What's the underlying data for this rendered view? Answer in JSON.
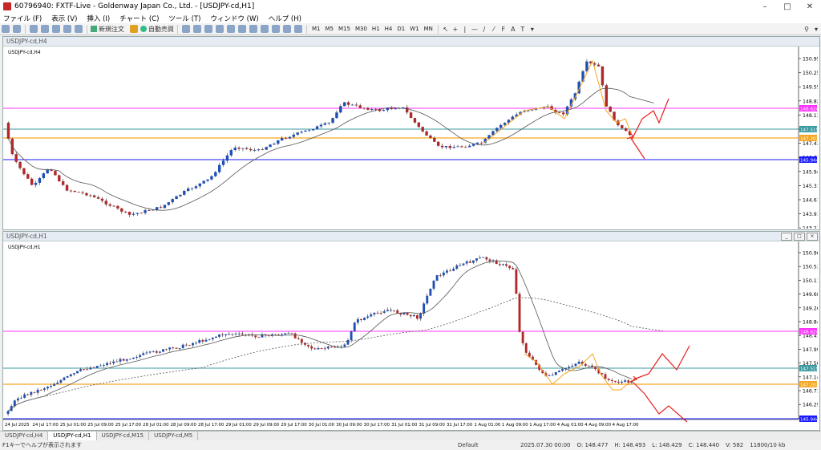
{
  "window": {
    "title": "60796940: FXTF-Live - Goldenway Japan Co., Ltd. - [USDJPY-cd,H1]"
  },
  "menu": [
    "ファイル (F)",
    "表示 (V)",
    "挿入 (I)",
    "チャート (C)",
    "ツール (T)",
    "ウィンドウ (W)",
    "ヘルプ (H)"
  ],
  "toolbar": {
    "new_order": "新規注文",
    "auto_trading": "自動売買",
    "timeframes": [
      "M1",
      "M5",
      "M15",
      "M30",
      "H1",
      "H4",
      "D1",
      "W1",
      "MN"
    ]
  },
  "colors": {
    "bull": "#1f4fb5",
    "bear": "#b0282a",
    "magenta": "#ff33ff",
    "teal": "#3a9aa0",
    "orange": "#f5a623",
    "blue": "#1a1aff",
    "red": "#e8201c"
  },
  "chart_h4": {
    "title": "USDJPY-cd,H4",
    "price_labels": [
      "150.950",
      "150.250",
      "149.550",
      "148.820",
      "148.130",
      "147.515",
      "147.430",
      "146.730",
      "145.944",
      "145.310",
      "144.610",
      "143.910",
      "143.210"
    ],
    "levels": {
      "magenta": "148.624",
      "teal": "147.515",
      "orange": "147.203",
      "blue": "145.944"
    }
  },
  "chart_h1": {
    "title": "USDJPY-cd,H1",
    "price_labels": [
      "150.960",
      "150.530",
      "150.110",
      "149.680",
      "149.260",
      "148.840",
      "148.410",
      "147.990",
      "147.560",
      "147.140",
      "146.710",
      "146.290",
      "145.860"
    ],
    "levels": {
      "magenta": "148.624",
      "teal": "147.515",
      "orange": "147.203",
      "blue": "145.944"
    },
    "time_labels": [
      "24 Jul 2025",
      "24 Jul 17:00",
      "25 Jul 01:00",
      "25 Jul 09:00",
      "25 Jul 17:00",
      "28 Jul 01:00",
      "28 Jul 09:00",
      "28 Jul 17:00",
      "29 Jul 01:00",
      "29 Jul 09:00",
      "29 Jul 17:00",
      "30 Jul 01:00",
      "30 Jul 09:00",
      "30 Jul 17:00",
      "31 Jul 01:00",
      "31 Jul 09:00",
      "31 Jul 17:00",
      "1 Aug 01:00",
      "1 Aug 09:00",
      "1 Aug 17:00",
      "4 Aug 01:00",
      "4 Aug 09:00",
      "4 Aug 17:00"
    ]
  },
  "tabs": [
    "USDJPY-cd,H4",
    "USDJPY-cd,H1",
    "USDJPY-cd,M15",
    "USDJPY-cd,M5"
  ],
  "active_tab": 1,
  "status": {
    "help": "F1キーでヘルプが表示されます",
    "profile": "Default",
    "datetime": "2025.07.30 00:00",
    "open": "O: 148.477",
    "high": "H: 148.493",
    "low": "L: 148.429",
    "close": "C: 148.440",
    "volume": "V: 582",
    "traffic": "11800/10 kb"
  }
}
